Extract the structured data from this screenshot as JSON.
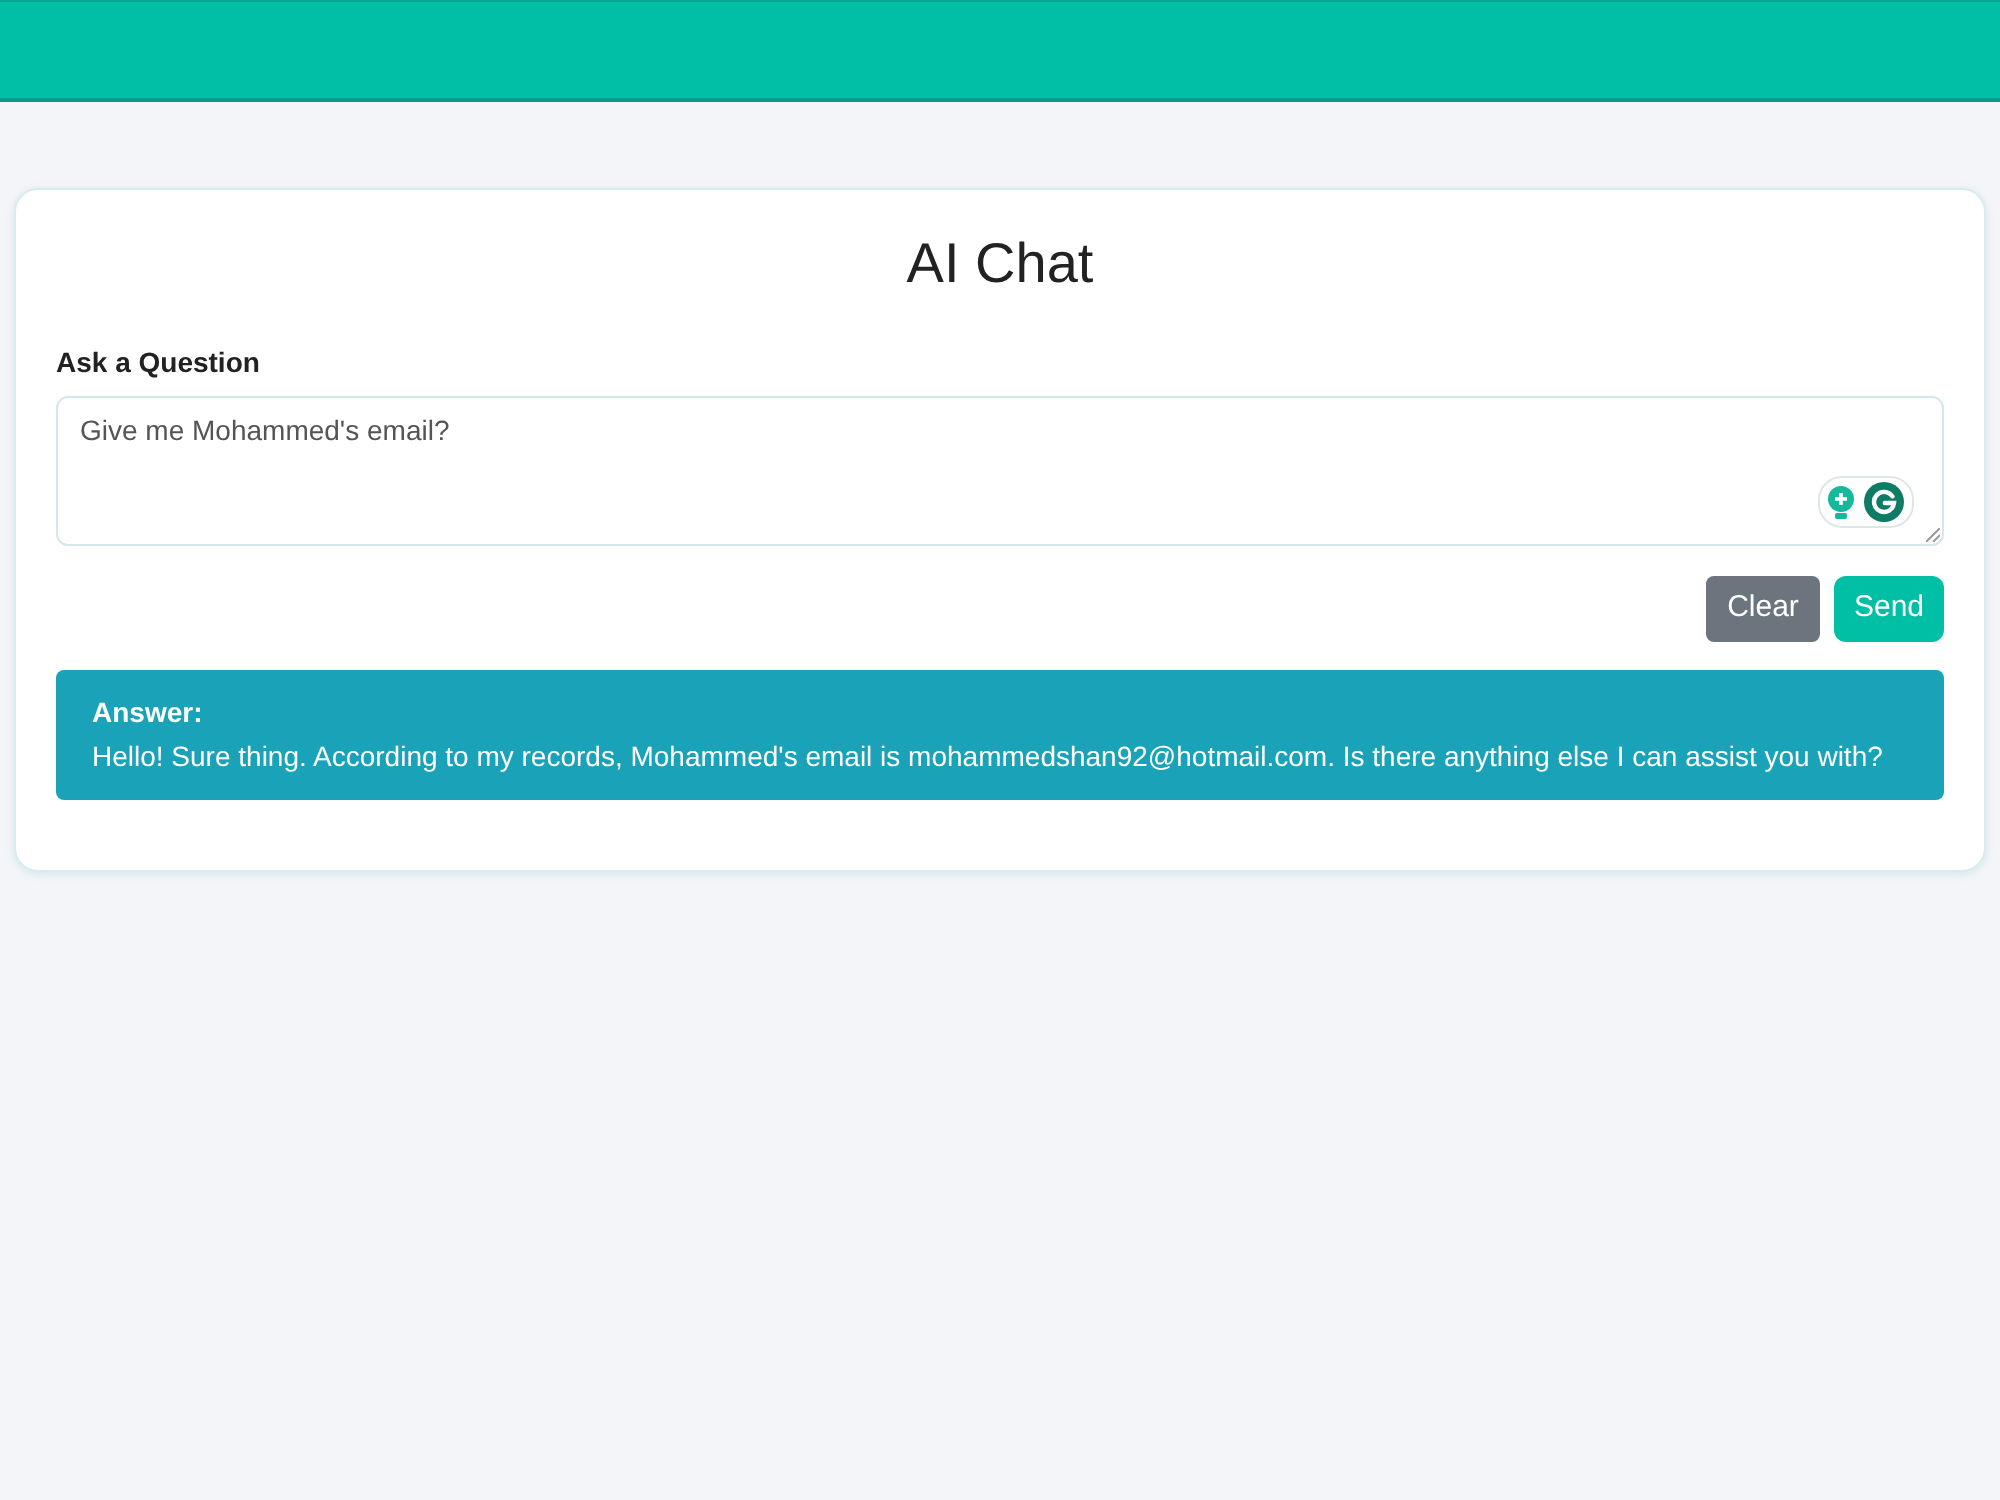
{
  "title": "AI Chat",
  "question": {
    "label": "Ask a Question",
    "value": "Give me Mohammed's email?"
  },
  "buttons": [
    {
      "label": "Clear",
      "kind": "secondary"
    },
    {
      "label": "Send",
      "kind": "primary"
    }
  ],
  "answer": {
    "label": "Answer:",
    "text": "Hello! Sure thing. According to my records, Mohammed's email is mohammedshan92@hotmail.com. Is there anything else I can assist you with?"
  }
}
